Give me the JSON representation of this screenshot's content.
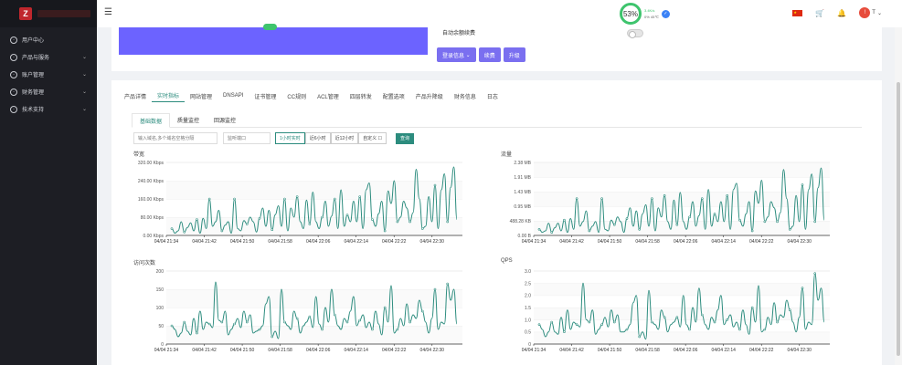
{
  "sidebar": {
    "items": [
      {
        "label": "用户中心",
        "icon": "user-icon",
        "has_children": false
      },
      {
        "label": "产品与服务",
        "icon": "gear-icon",
        "has_children": true
      },
      {
        "label": "账户管理",
        "icon": "person-icon",
        "has_children": true
      },
      {
        "label": "财务管理",
        "icon": "coin-icon",
        "has_children": true
      },
      {
        "label": "技术支持",
        "icon": "doc-icon",
        "has_children": true
      }
    ]
  },
  "topbar": {
    "monitor_percent": "53%",
    "net_line1": "3.4K/s",
    "net_line2": "0% 45℃",
    "user_initial": "T"
  },
  "panel_top": {
    "autorenew_label": "自动余额续费",
    "buttons": [
      "登录信息",
      "续费",
      "升级"
    ]
  },
  "tabs": {
    "items": [
      "产品详情",
      "实时指标",
      "网站管理",
      "DNSAPI",
      "证书管理",
      "CC规则",
      "ACL管理",
      "四层转发",
      "配置选项",
      "产品升降级",
      "财务信息",
      "日志"
    ],
    "active": 1
  },
  "subtabs": {
    "items": [
      "基础数据",
      "质量监控",
      "回源监控"
    ],
    "active": 0
  },
  "filters": {
    "domain_placeholder": "输入域名,多个域名空格分隔",
    "port_placeholder": "监听端口",
    "ranges": [
      "1小时实时",
      "近6小时",
      "近12小时",
      "自定义 ☐"
    ],
    "active_range": 0,
    "query_label": "查询"
  },
  "chart_data": [
    {
      "type": "line",
      "title": "带宽",
      "x": [
        "04/04 21:34",
        "04/04 21:42",
        "04/04 21:50",
        "04/04 21:58",
        "04/04 22:06",
        "04/04 22:14",
        "04/04 22:22",
        "04/04 22:30"
      ],
      "yticks": [
        "0.00 Kbps",
        "80.00 Kbps",
        "160.00 Kbps",
        "240.00 Kbps",
        "320.00 Kbps"
      ],
      "ylim": [
        0,
        320
      ],
      "values": [
        30,
        10,
        20,
        60,
        15,
        35,
        55,
        20,
        70,
        10,
        75,
        30,
        160,
        40,
        60,
        110,
        20,
        45,
        60,
        10,
        160,
        30,
        20,
        65,
        50,
        80,
        60,
        15,
        75,
        120,
        40,
        110,
        25,
        90,
        130,
        40,
        160,
        20,
        120,
        80,
        170,
        60,
        30,
        155,
        50,
        190,
        60,
        30,
        80,
        150,
        40,
        85,
        160,
        30,
        200,
        40,
        90,
        60,
        150,
        60,
        170,
        30,
        200,
        230,
        70,
        40,
        95,
        150,
        20,
        195,
        140,
        240,
        60,
        80,
        150,
        120,
        60,
        100,
        290,
        160,
        30,
        40,
        170,
        60,
        220,
        30,
        200,
        270,
        60,
        210,
        300,
        70
      ],
      "color": "#2c8c7e"
    },
    {
      "type": "line",
      "title": "流量",
      "x": [
        "04/04 21:34",
        "04/04 21:42",
        "04/04 21:50",
        "04/04 21:58",
        "04/04 22:06",
        "04/04 22:14",
        "04/04 22:22",
        "04/04 22:30"
      ],
      "yticks": [
        "0.00 B",
        "488.28 KB",
        "0.95 MB",
        "1.43 MB",
        "1.91 MB",
        "2.38 MB"
      ],
      "ylim": [
        0,
        2.38
      ],
      "values": [
        0.2,
        0.1,
        0.15,
        0.4,
        0.1,
        0.25,
        0.4,
        0.15,
        0.5,
        0.1,
        0.55,
        0.2,
        1.2,
        0.3,
        0.45,
        0.8,
        0.15,
        0.3,
        0.45,
        0.1,
        1.2,
        0.2,
        0.15,
        0.5,
        0.35,
        0.6,
        0.45,
        0.1,
        0.55,
        0.9,
        0.3,
        0.8,
        0.2,
        0.7,
        1.0,
        0.3,
        1.2,
        0.15,
        0.9,
        0.6,
        1.3,
        0.45,
        0.2,
        1.15,
        0.35,
        1.4,
        0.45,
        0.2,
        0.6,
        1.1,
        0.3,
        0.65,
        1.2,
        0.2,
        1.5,
        0.3,
        0.7,
        0.45,
        1.1,
        0.45,
        1.3,
        0.2,
        1.5,
        1.7,
        0.5,
        0.3,
        0.7,
        1.1,
        0.15,
        1.45,
        1.05,
        1.8,
        0.45,
        0.6,
        1.1,
        0.9,
        0.45,
        0.75,
        2.15,
        1.2,
        0.2,
        0.3,
        1.3,
        0.45,
        1.65,
        0.2,
        1.5,
        2.0,
        0.45,
        1.55,
        2.2,
        0.5
      ],
      "color": "#2c8c7e"
    },
    {
      "type": "line",
      "title": "访问次数",
      "x": [
        "04/04 21:34",
        "04/04 21:42",
        "04/04 21:50",
        "04/04 21:58",
        "04/04 22:06",
        "04/04 22:14",
        "04/04 22:22",
        "04/04 22:30"
      ],
      "yticks": [
        "0",
        "50",
        "100",
        "150",
        "200"
      ],
      "ylim": [
        0,
        200
      ],
      "values": [
        50,
        40,
        20,
        30,
        60,
        35,
        25,
        70,
        30,
        90,
        40,
        60,
        55,
        45,
        170,
        65,
        60,
        90,
        25,
        40,
        55,
        70,
        45,
        90,
        60,
        80,
        30,
        35,
        40,
        50,
        110,
        130,
        20,
        35,
        15,
        150,
        60,
        50,
        40,
        90,
        70,
        30,
        50,
        60,
        75,
        45,
        130,
        55,
        40,
        100,
        60,
        150,
        80,
        50,
        40,
        70,
        60,
        90,
        130,
        50,
        65,
        80,
        45,
        60,
        40,
        90,
        55,
        25,
        100,
        60,
        160,
        30,
        40,
        70,
        50,
        110,
        60,
        80,
        70,
        120,
        90,
        60,
        30,
        70,
        150,
        40,
        60,
        55,
        165,
        120,
        150,
        55
      ],
      "color": "#2c8c7e"
    },
    {
      "type": "line",
      "title": "QPS",
      "x": [
        "04/04 21:34",
        "04/04 21:42",
        "04/04 21:50",
        "04/04 21:58",
        "04/04 22:06",
        "04/04 22:14",
        "04/04 22:22",
        "04/04 22:30"
      ],
      "yticks": [
        "0",
        "0.5",
        "1.0",
        "1.5",
        "2.0",
        "2.5",
        "3.0"
      ],
      "ylim": [
        0,
        3
      ],
      "values": [
        0.8,
        0.6,
        0.3,
        0.5,
        0.9,
        0.5,
        0.4,
        1.1,
        0.5,
        1.4,
        0.6,
        0.9,
        0.8,
        0.7,
        2.5,
        1.0,
        0.9,
        1.4,
        0.4,
        0.6,
        0.8,
        1.1,
        0.7,
        1.4,
        0.9,
        1.2,
        0.5,
        0.5,
        0.6,
        0.8,
        1.7,
        2.0,
        0.3,
        0.5,
        0.2,
        2.2,
        0.9,
        0.8,
        0.6,
        1.4,
        1.1,
        0.5,
        0.8,
        0.9,
        1.1,
        0.7,
        2.0,
        0.8,
        0.6,
        1.5,
        0.9,
        2.3,
        1.2,
        0.8,
        0.6,
        1.1,
        0.9,
        1.4,
        2.0,
        0.8,
        1.0,
        1.2,
        0.7,
        0.9,
        0.6,
        1.4,
        0.8,
        0.4,
        1.5,
        0.9,
        2.4,
        0.5,
        0.6,
        1.1,
        0.8,
        1.7,
        0.9,
        1.2,
        1.1,
        1.8,
        1.4,
        0.9,
        0.5,
        1.1,
        2.3,
        0.6,
        0.9,
        0.8,
        2.9,
        1.8,
        2.3,
        0.9
      ],
      "color": "#2c8c7e"
    }
  ]
}
